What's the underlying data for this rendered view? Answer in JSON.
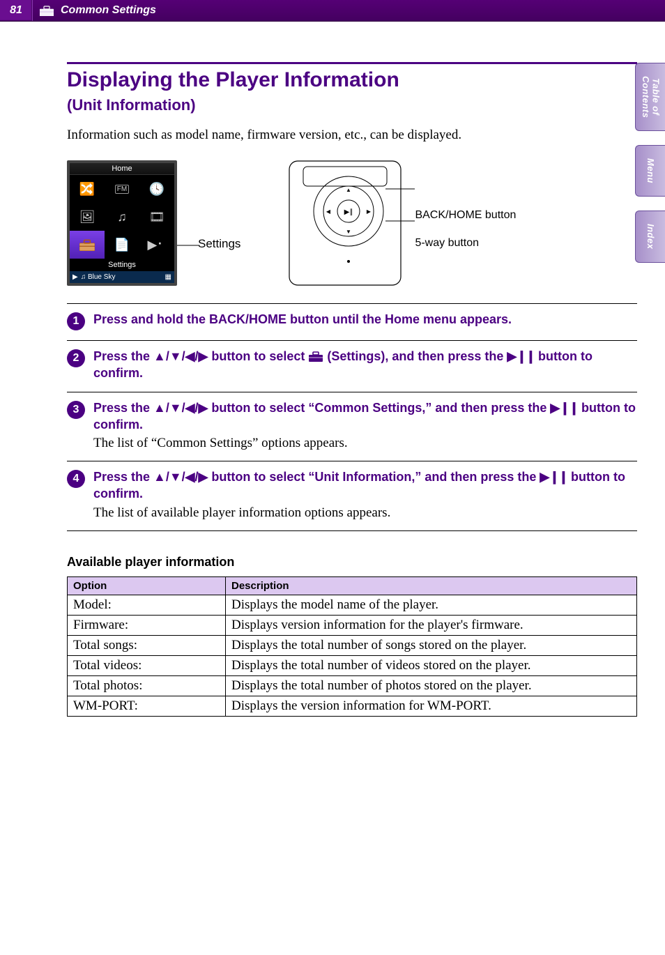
{
  "header": {
    "page_number": "81",
    "section": "Common Settings"
  },
  "title": "Displaying the Player Information",
  "subtitle": "(Unit Information)",
  "intro": "Information such as model name, firmware version, etc., can be displayed.",
  "screen": {
    "top_label": "Home",
    "bottom_label": "Settings",
    "now_playing_indicator": "▶",
    "now_playing_track": "♫ Blue Sky",
    "now_playing_extra": "▦"
  },
  "callouts": {
    "settings": "Settings",
    "back_home": "BACK/HOME button",
    "fiveway": "5-way button"
  },
  "steps": [
    {
      "num": "1",
      "instruction_parts": [
        "Press and hold the BACK/HOME button until the Home menu appears."
      ],
      "result": ""
    },
    {
      "num": "2",
      "instruction_parts": [
        "Press the ",
        "▲/▼/◀/▶",
        " button to select ",
        "TOOLBOX",
        " (Settings), and then press the ",
        "▶∥",
        " button to confirm."
      ],
      "result": ""
    },
    {
      "num": "3",
      "instruction_parts": [
        "Press the ",
        "▲/▼/◀/▶",
        " button to select “Common Settings,” and then press the ",
        "▶∥",
        " button to confirm."
      ],
      "result": "The list of “Common Settings” options appears."
    },
    {
      "num": "4",
      "instruction_parts": [
        "Press the ",
        "▲/▼/◀/▶",
        " button to select “Unit Information,” and then press the ",
        "▶∥",
        " button to confirm."
      ],
      "result": "The list of available player information options appears."
    }
  ],
  "table_heading": "Available player information",
  "table": {
    "headers": [
      "Option",
      "Description"
    ],
    "rows": [
      [
        "Model:",
        "Displays the model name of the player."
      ],
      [
        "Firmware:",
        "Displays version information for the player's firmware."
      ],
      [
        "Total songs:",
        "Displays the total number of songs stored on the player."
      ],
      [
        "Total videos:",
        "Displays the total number of videos stored on the player."
      ],
      [
        "Total photos:",
        "Displays the total number of photos stored on the player."
      ],
      [
        "WM-PORT:",
        "Displays the version information for WM-PORT."
      ]
    ]
  },
  "sidetabs": {
    "toc": "Table of\nContents",
    "menu": "Menu",
    "index": "Index"
  },
  "colors": {
    "accent": "#4b0082"
  }
}
